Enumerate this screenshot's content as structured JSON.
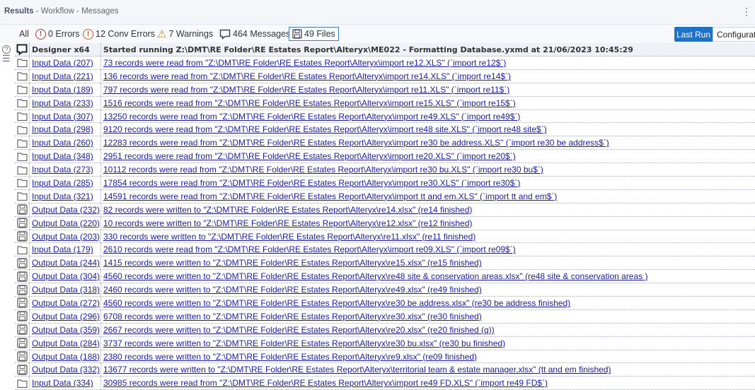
{
  "header": {
    "title": "Results",
    "breadcrumb": [
      "Workflow",
      "Messages"
    ]
  },
  "toolbar": {
    "all": "All",
    "errors": "0 Errors",
    "conv_errors": "12 Conv Errors",
    "warnings": "7 Warnings",
    "messages": "464 Messages",
    "files": "49 Files",
    "last_run": "Last Run",
    "configuration": "Configurat"
  },
  "colors": {
    "accent": "#1f72c8",
    "error": "#c0392b",
    "conv": "#d05a30",
    "warning": "#c08a3a",
    "link": "#1a1aa6"
  },
  "grid": {
    "head": {
      "tool": "Designer x64",
      "message": "Started running Z:\\DMT\\RE Folder\\RE Estates Report\\Alteryx\\ME022 - Formatting Database.yxmd at 21/06/2023 10:45:29"
    },
    "rows": [
      {
        "icon": "folder",
        "tool": "Input Data (207)",
        "message": "73 records were read from \"Z:\\DMT\\RE Folder\\RE Estates Report\\Alteryx\\import re12.XLS\" (`import re12$`)"
      },
      {
        "icon": "folder",
        "tool": "Input Data (221)",
        "message": "136 records were read from \"Z:\\DMT\\RE Folder\\RE Estates Report\\Alteryx\\import re14.XLS\" (`import re14$`)"
      },
      {
        "icon": "folder",
        "tool": "Input Data (189)",
        "message": "797 records were read from \"Z:\\DMT\\RE Folder\\RE Estates Report\\Alteryx\\import re11.XLS\" (`import re11$`)"
      },
      {
        "icon": "folder",
        "tool": "Input Data (233)",
        "message": "1516 records were read from \"Z:\\DMT\\RE Folder\\RE Estates Report\\Alteryx\\import re15.XLS\" (`import re15$`)"
      },
      {
        "icon": "folder",
        "tool": "Input Data (307)",
        "message": "13250 records were read from \"Z:\\DMT\\RE Folder\\RE Estates Report\\Alteryx\\import re49.XLS\" (`import re49$`)"
      },
      {
        "icon": "folder",
        "tool": "Input Data (298)",
        "message": "9120 records were read from \"Z:\\DMT\\RE Folder\\RE Estates Report\\Alteryx\\import re48 site.XLS\" (`import re48 site$`)"
      },
      {
        "icon": "folder",
        "tool": "Input Data (260)",
        "message": "12283 records were read from \"Z:\\DMT\\RE Folder\\RE Estates Report\\Alteryx\\import re30 be address.XLS\" (`import re30 be address$`)"
      },
      {
        "icon": "folder",
        "tool": "Input Data (348)",
        "message": "2951 records were read from \"Z:\\DMT\\RE Folder\\RE Estates Report\\Alteryx\\import re20.XLS\" (`import re20$`)"
      },
      {
        "icon": "folder",
        "tool": "Input Data (273)",
        "message": "10112 records were read from \"Z:\\DMT\\RE Folder\\RE Estates Report\\Alteryx\\import re30 bu.XLS\" (`import re30 bu$`)"
      },
      {
        "icon": "folder",
        "tool": "Input Data (285)",
        "message": "17854 records were read from \"Z:\\DMT\\RE Folder\\RE Estates Report\\Alteryx\\import re30.XLS\" (`import re30$`)"
      },
      {
        "icon": "folder",
        "tool": "Input Data (321)",
        "message": "14591 records were read from \"Z:\\DMT\\RE Folder\\RE Estates Report\\Alteryx\\import tt and em.XLS\" (`import tt and em$`)"
      },
      {
        "icon": "save",
        "tool": "Output Data (232)",
        "message": "82 records were written to \"Z:\\DMT\\RE Folder\\RE Estates Report\\Alteryx\\re14.xlsx\" (re14 finished)"
      },
      {
        "icon": "save",
        "tool": "Output Data (220)",
        "message": "10 records were written to \"Z:\\DMT\\RE Folder\\RE Estates Report\\Alteryx\\re12.xlsx\" (re12 finished)"
      },
      {
        "icon": "save",
        "tool": "Output Data (203)",
        "message": "330 records were written to \"Z:\\DMT\\RE Folder\\RE Estates Report\\Alteryx\\re11.xlsx\" (re11 finished)"
      },
      {
        "icon": "folder",
        "tool": "Input Data (179)",
        "message": "2610 records were read from \"Z:\\DMT\\RE Folder\\RE Estates Report\\Alteryx\\import re09.XLS\" (`import re09$`)"
      },
      {
        "icon": "save",
        "tool": "Output Data (244)",
        "message": "1415 records were written to \"Z:\\DMT\\RE Folder\\RE Estates Report\\Alteryx\\re15.xlsx\" (re15 finished)"
      },
      {
        "icon": "save",
        "tool": "Output Data (304)",
        "message": "4560 records were written to \"Z:\\DMT\\RE Folder\\RE Estates Report\\Alteryx\\re48 site & conservation areas.xlsx\" (re48 site & conservation areas )"
      },
      {
        "icon": "save",
        "tool": "Output Data (318)",
        "message": "2460 records were written to \"Z:\\DMT\\RE Folder\\RE Estates Report\\Alteryx\\re49.xlsx\" (re49 finished)"
      },
      {
        "icon": "save",
        "tool": "Output Data (272)",
        "message": "4560 records were written to \"Z:\\DMT\\RE Folder\\RE Estates Report\\Alteryx\\re30 be address.xlsx\" (re30 be address finished)"
      },
      {
        "icon": "save",
        "tool": "Output Data (296)",
        "message": "6708 records were written to \"Z:\\DMT\\RE Folder\\RE Estates Report\\Alteryx\\re30.xlsx\" (re30 finished)"
      },
      {
        "icon": "save",
        "tool": "Output Data (359)",
        "message": "2667 records were written to \"Z:\\DMT\\RE Folder\\RE Estates Report\\Alteryx\\re20.xlsx\" (re20 finished (q))"
      },
      {
        "icon": "save",
        "tool": "Output Data (284)",
        "message": "3737 records were written to \"Z:\\DMT\\RE Folder\\RE Estates Report\\Alteryx\\re30 bu.xlsx\" (re30 bu finished)"
      },
      {
        "icon": "save",
        "tool": "Output Data (188)",
        "message": "2380 records were written to \"Z:\\DMT\\RE Folder\\RE Estates Report\\Alteryx\\re9.xlsx\" (re09 finished)"
      },
      {
        "icon": "save",
        "tool": "Output Data (332)",
        "message": "13677 records were written to \"Z:\\DMT\\RE Folder\\RE Estates Report\\Alteryx\\territorial team & estate manager.xlsx\" (tt and em finished)"
      },
      {
        "icon": "folder",
        "tool": "Input Data (334)",
        "message": "30985 records were read from \"Z:\\DMT\\RE Folder\\RE Estates Report\\Alteryx\\import re49 FD.XLS\" (`import re49 FD$`)"
      }
    ]
  }
}
